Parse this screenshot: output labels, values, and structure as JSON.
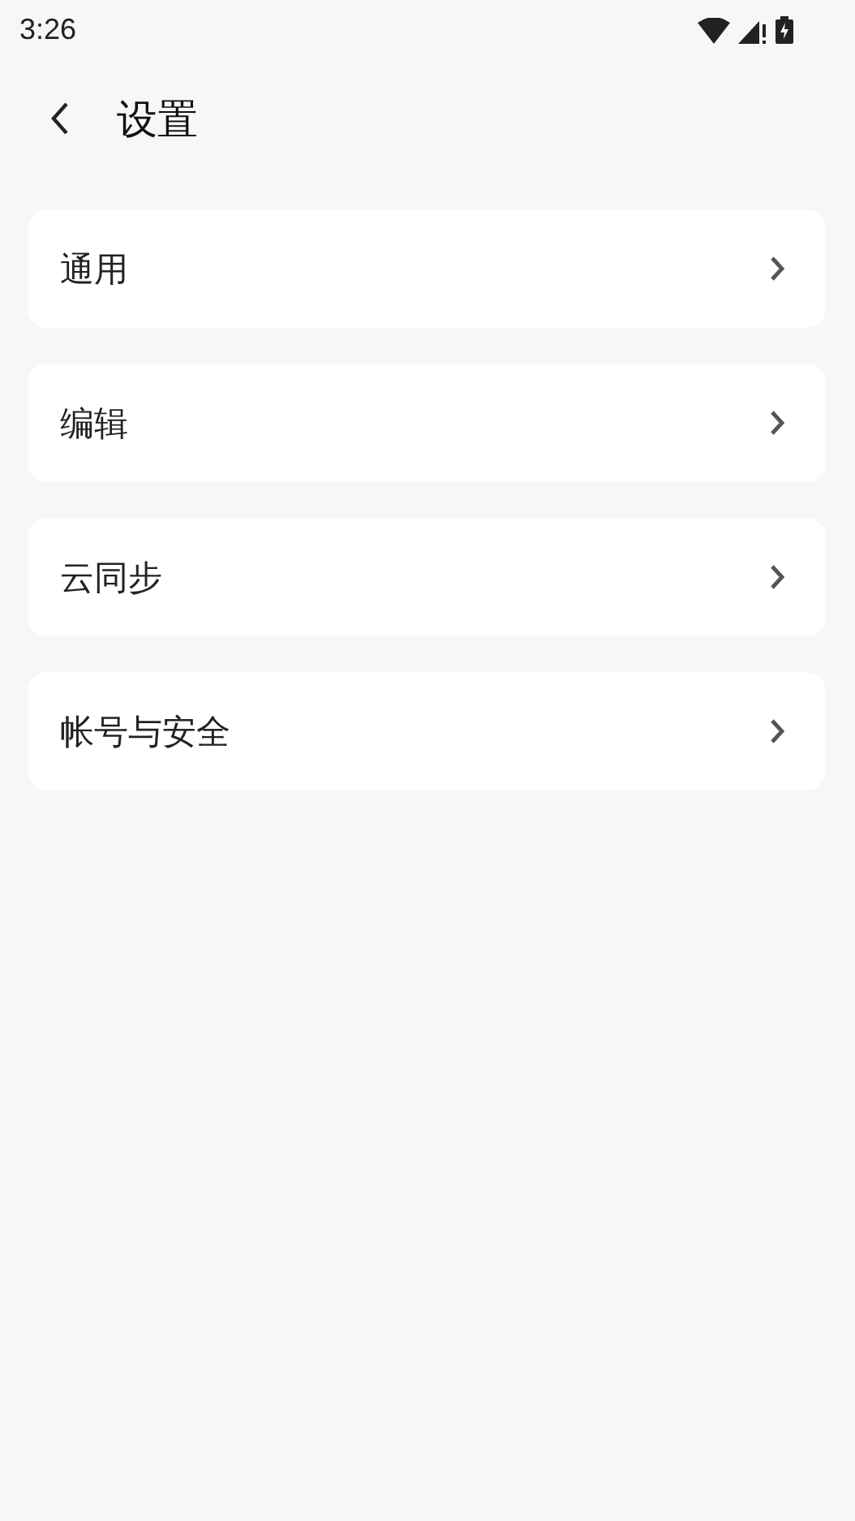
{
  "status_bar": {
    "time": "3:26"
  },
  "header": {
    "title": "设置"
  },
  "items": [
    {
      "label": "通用"
    },
    {
      "label": "编辑"
    },
    {
      "label": "云同步"
    },
    {
      "label": "帐号与安全"
    }
  ]
}
